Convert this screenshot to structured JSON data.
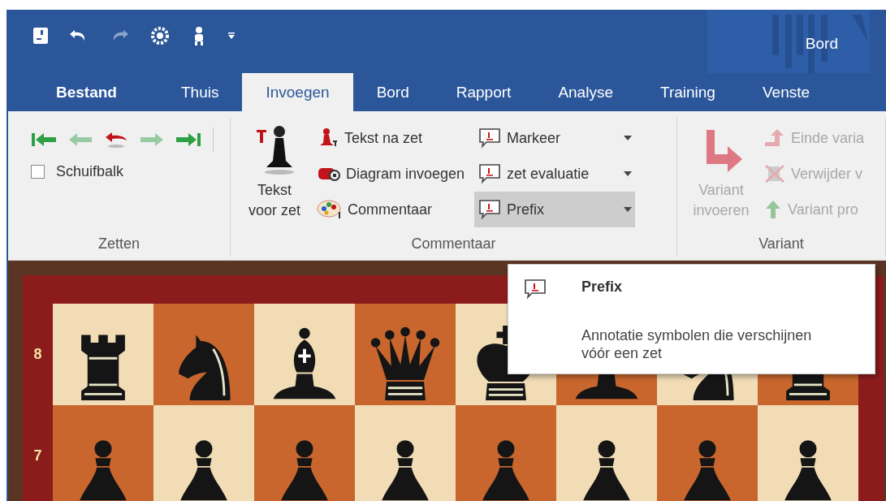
{
  "quick_access_toolbar": [
    {
      "kind": "save",
      "disabled": false
    },
    {
      "kind": "undo",
      "disabled": false
    },
    {
      "kind": "redo",
      "disabled": true
    },
    {
      "kind": "engine",
      "disabled": false
    },
    {
      "kind": "figure",
      "disabled": false
    },
    {
      "kind": "customize",
      "disabled": false
    }
  ],
  "window": {
    "title": "Bord"
  },
  "tabs": [
    {
      "label": "Bestand",
      "selected": false
    },
    {
      "label": "Thuis",
      "selected": false
    },
    {
      "label": "Invoegen",
      "selected": true
    },
    {
      "label": "Bord",
      "selected": false
    },
    {
      "label": "Rapport",
      "selected": false
    },
    {
      "label": "Analyse",
      "selected": false
    },
    {
      "label": "Training",
      "selected": false
    },
    {
      "label": "Venste",
      "selected": false
    }
  ],
  "ribbon": {
    "zetten": {
      "label": "Zetten",
      "nav_buttons": [
        {
          "kind": "first",
          "disabled": false
        },
        {
          "kind": "back",
          "disabled": true
        },
        {
          "kind": "takeback",
          "disabled": false
        },
        {
          "kind": "forward",
          "disabled": true
        },
        {
          "kind": "last",
          "disabled": false
        }
      ],
      "checkbox": {
        "label": "Schuifbalk",
        "checked": false
      }
    },
    "commentaar": {
      "label": "Commentaar",
      "large_button": {
        "kind": "pawn-text",
        "label": "Tekst voor zet",
        "disabled": false
      },
      "buttons": [
        {
          "kind": "pawn",
          "label": "Tekst na zet",
          "disabled": false
        },
        {
          "kind": "diagram",
          "label": "Diagram invoegen",
          "disabled": false
        },
        {
          "kind": "palette",
          "label": "Commentaar",
          "disabled": false
        }
      ],
      "dropdowns": [
        {
          "kind": "bubble",
          "label": "Markeer",
          "selected": false
        },
        {
          "kind": "bubble",
          "label": "zet evaluatie",
          "selected": false
        },
        {
          "kind": "bubble",
          "label": "Prefix",
          "selected": true
        }
      ]
    },
    "variant": {
      "label": "Variant",
      "large_button": {
        "kind": "branch",
        "label": "Variant invoeren",
        "disabled": true
      },
      "buttons": [
        {
          "kind": "end",
          "label": "Einde varia",
          "disabled": true
        },
        {
          "kind": "delete",
          "label": "Verwijder v",
          "disabled": true
        },
        {
          "kind": "promote",
          "label": "Variant pro",
          "disabled": true
        }
      ]
    }
  },
  "board": {
    "ranks": [
      {
        "label": "8",
        "pieces": [
          {
            "kind": "rook"
          },
          {
            "kind": "knight"
          },
          {
            "kind": "bishop"
          },
          {
            "kind": "queen"
          },
          {
            "kind": "king"
          },
          {
            "kind": "bishop"
          },
          {
            "kind": "knight"
          },
          {
            "kind": "rook"
          }
        ]
      },
      {
        "label": "7",
        "pieces": [
          {
            "kind": "pawn"
          },
          {
            "kind": "pawn"
          },
          {
            "kind": "pawn"
          },
          {
            "kind": "pawn"
          },
          {
            "kind": "pawn"
          },
          {
            "kind": "pawn"
          },
          {
            "kind": "pawn"
          },
          {
            "kind": "pawn"
          }
        ]
      }
    ]
  },
  "tooltip": {
    "title": "Prefix",
    "description": "Annotatie symbolen die verschijnen vóór een zet"
  }
}
